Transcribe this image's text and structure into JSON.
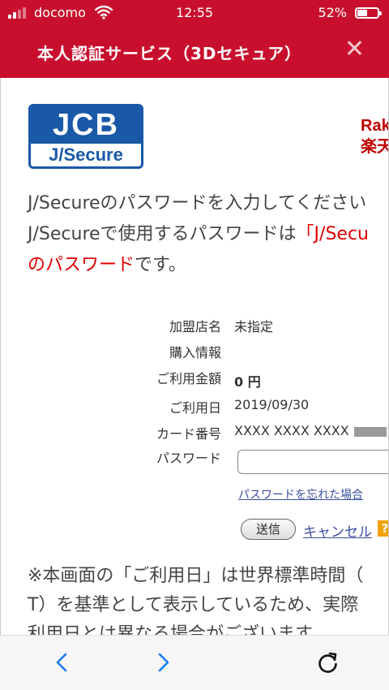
{
  "status_bar": {
    "carrier": "docomo",
    "time": "12:55",
    "battery_percent": "52%",
    "battery_level": 0.52
  },
  "header": {
    "title": "本人認証サービス（3Dセキュア）",
    "close_label": "✕"
  },
  "logos": {
    "jcb_top": "JCB",
    "jcb_bottom": "J/Secure",
    "rakuten_line1": "Rak",
    "rakuten_line2": "楽天"
  },
  "intro": {
    "line1": "J/Secureのパスワードを入力してください",
    "line2_prefix": "J/Secureで使用するパスワードは",
    "line2_red": "「J/Secu",
    "line3_red": "のパスワード",
    "line3_suffix": "です。"
  },
  "form": {
    "merchant_label": "加盟店名",
    "merchant_value": "未指定",
    "purchase_label": "購入情報",
    "amount_label": "ご利用金額",
    "amount_value": "0 円",
    "date_label": "ご利用日",
    "date_value": "2019/09/30",
    "card_label": "カード番号",
    "card_value": "XXXX XXXX XXXX",
    "password_label": "パスワード",
    "password_value": "",
    "forgot_link": "パスワードを忘れた場合",
    "submit_label": "送信",
    "cancel_label": "キャンセル",
    "help_label": "?"
  },
  "note": {
    "line1": "※本画面の「ご利用日」は世界標準時間（",
    "line2": "T）を基準として表示しているため、実際",
    "line3": "利用日とは異なる場合がございます。"
  },
  "toolbar": {
    "icons": [
      "back-icon",
      "forward-icon",
      "reload-icon"
    ]
  },
  "colors": {
    "brand_red": "#c8102e",
    "jcb_blue": "#1a58a8",
    "link_blue": "#3a4fa0",
    "text_red": "#e00000"
  }
}
